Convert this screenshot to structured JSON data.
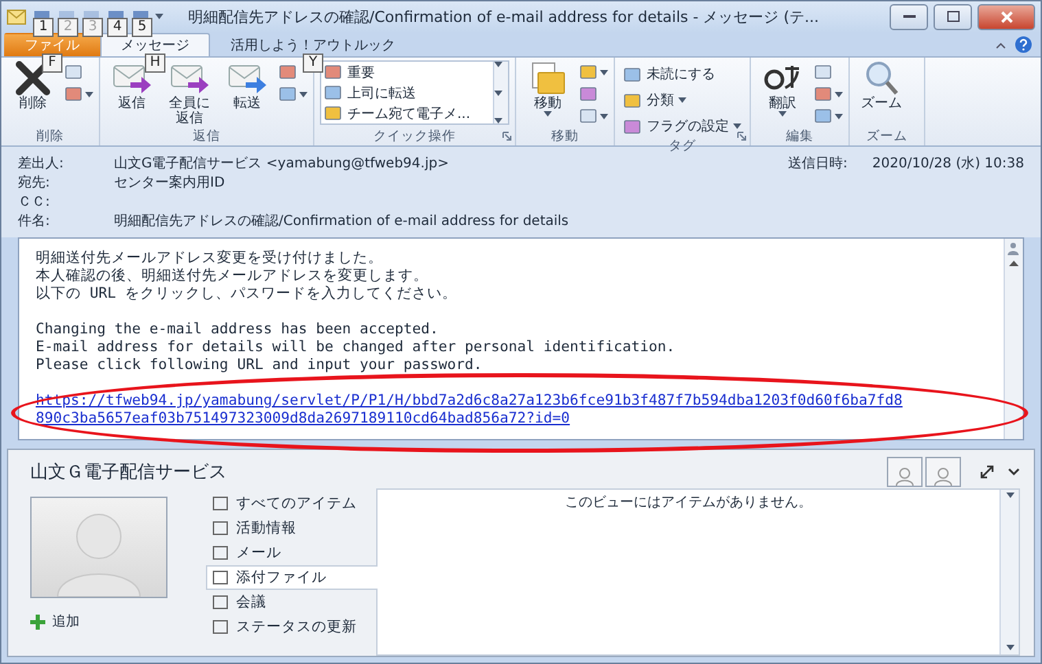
{
  "window": {
    "title": "明細配信先アドレスの確認/Confirmation of e-mail address for details - メッセージ (テ...",
    "quick_access": [
      {
        "label": "1",
        "disabled": false
      },
      {
        "label": "2",
        "disabled": true
      },
      {
        "label": "3",
        "disabled": true
      },
      {
        "label": "4",
        "disabled": false
      },
      {
        "label": "5",
        "disabled": false
      }
    ]
  },
  "tabs": [
    {
      "label": "ファイル",
      "kind": "file",
      "selected": false,
      "keytip": "F"
    },
    {
      "label": "メッセージ",
      "kind": "tab",
      "selected": true,
      "keytip": "H"
    },
    {
      "label": "活用しよう！アウトルック",
      "kind": "tab",
      "selected": false,
      "keytip": "Y"
    }
  ],
  "ribbon": [
    {
      "label": "削除",
      "launcher": false,
      "items": [
        {
          "kind": "large",
          "label": "削除",
          "dropdown": false
        },
        {
          "kind": "icons",
          "icons": [
            {
              "dropdown": false
            },
            {
              "dropdown": true
            }
          ]
        }
      ]
    },
    {
      "label": "返信",
      "launcher": false,
      "items": [
        {
          "kind": "large",
          "label": "返信",
          "dropdown": false
        },
        {
          "kind": "large",
          "label": "全員に返信",
          "dropdown": false
        },
        {
          "kind": "large",
          "label": "転送",
          "dropdown": false
        },
        {
          "kind": "icons",
          "icons": [
            {
              "dropdown": false
            },
            {
              "dropdown": true
            }
          ]
        }
      ]
    },
    {
      "label": "クイック操作",
      "launcher": true,
      "items": [
        {
          "kind": "quick",
          "entries": [
            "重要",
            "上司に転送",
            "チーム宛て電子メ..."
          ]
        }
      ]
    },
    {
      "label": "移動",
      "launcher": false,
      "items": [
        {
          "kind": "large",
          "label": "移動",
          "dropdown": true
        },
        {
          "kind": "icons",
          "icons": [
            {
              "dropdown": true
            },
            {
              "dropdown": false
            },
            {
              "dropdown": true
            }
          ]
        }
      ]
    },
    {
      "label": "タグ",
      "launcher": true,
      "items": [
        {
          "kind": "small",
          "entries": [
            {
              "label": "未読にする",
              "dropdown": false
            },
            {
              "label": "分類",
              "dropdown": true
            },
            {
              "label": "フラグの設定",
              "dropdown": true
            }
          ]
        }
      ]
    },
    {
      "label": "編集",
      "launcher": false,
      "items": [
        {
          "kind": "large",
          "label": "翻訳",
          "dropdown": true
        },
        {
          "kind": "icons",
          "icons": [
            {
              "dropdown": false
            },
            {
              "dropdown": true
            },
            {
              "dropdown": true
            }
          ]
        }
      ]
    },
    {
      "label": "ズーム",
      "launcher": false,
      "items": [
        {
          "kind": "large",
          "label": "ズーム",
          "dropdown": false
        }
      ]
    }
  ],
  "header": {
    "fields": [
      {
        "label": "差出人:",
        "value": "山文G電子配信サービス <yamabung@tfweb94.jp>"
      },
      {
        "label": "宛先:",
        "value": "センター案内用ID"
      },
      {
        "label": "ＣＣ:"
      },
      {
        "label": "件名:",
        "value": "明細配信先アドレスの確認/Confirmation of e-mail address for details"
      }
    ],
    "sent": {
      "label": "送信日時:",
      "value": "2020/10/28 (水) 10:38"
    }
  },
  "body": {
    "paragraphs": [
      [
        "明細送付先メールアドレス変更を受け付けました。",
        "本人確認の後、明細送付先メールアドレスを変更します。",
        "以下の URL をクリックし、パスワードを入力してください。"
      ],
      [
        "Changing the e-mail address has been accepted.",
        "E-mail address for details will be changed after personal identification.",
        "Please click following URL and input your password."
      ]
    ],
    "link": [
      "https://tfweb94.jp/yamabung/servlet/P/P1/H/bbd7a2d6c8a27a123b6fce91b3f487f7b594dba1203f0d60f6ba7fd8",
      "890c3ba5657eaf03b751497323009d8da2697189110cd64bad856a72?id=0"
    ],
    "link_highlighted": true
  },
  "people_pane": {
    "name": "山文Ｇ電子配信サービス",
    "add_label": "追加",
    "nav": [
      {
        "label": "すべてのアイテム",
        "selected": false
      },
      {
        "label": "活動情報",
        "selected": false
      },
      {
        "label": "メール",
        "selected": false
      },
      {
        "label": "添付ファイル",
        "selected": true
      },
      {
        "label": "会議",
        "selected": false
      },
      {
        "label": "ステータスの更新",
        "selected": false
      }
    ],
    "empty_message": "このビューにはアイテムがありません。"
  }
}
